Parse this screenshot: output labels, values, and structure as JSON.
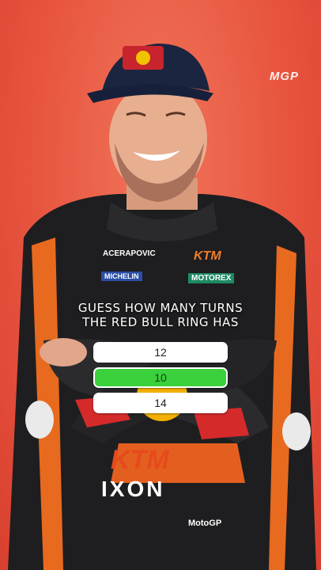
{
  "brand": {
    "logo_text": "MGP"
  },
  "suit": {
    "sponsor_left": "REDBULL",
    "rider_name": "ACERAPOVIC",
    "ktm": "KTM",
    "michelin": "MICHELIN",
    "motorex": "MOTOREX",
    "ixon": "IXON",
    "motogp": "MotoGP"
  },
  "quiz": {
    "question_line1": "GUESS HOW MANY TURNS",
    "question_line2": "THE RED BULL RING HAS",
    "options": [
      {
        "label": "12",
        "state": "neutral"
      },
      {
        "label": "10",
        "state": "correct"
      },
      {
        "label": "14",
        "state": "neutral"
      }
    ]
  },
  "colors": {
    "background": "#e8553f",
    "correct": "#3ad13d",
    "option": "#ffffff"
  }
}
